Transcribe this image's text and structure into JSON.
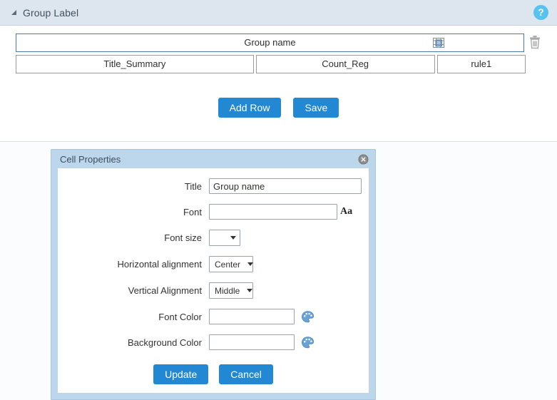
{
  "panel": {
    "title": "Group Label",
    "collapse_icon": "triangle-collapse-icon",
    "help_icon": "?",
    "help_icon_color": "#57c2ef"
  },
  "grid": {
    "rows": [
      {
        "selected": true,
        "cells": [
          {
            "text": "Group name"
          }
        ],
        "split_icon": "cell-split-icon",
        "delete_icon": "trash-icon"
      },
      {
        "selected": false,
        "cells": [
          {
            "text": "Title_Summary"
          },
          {
            "text": "Count_Reg"
          },
          {
            "text": "rule1"
          }
        ]
      }
    ]
  },
  "toolbar": {
    "add_row_label": "Add Row",
    "save_label": "Save",
    "button_color": "#2288d4"
  },
  "dialog": {
    "title": "Cell Properties",
    "close_icon": "close-circle-icon",
    "fields": {
      "title": {
        "label": "Title",
        "value": "Group name",
        "placeholder": ""
      },
      "font": {
        "label": "Font",
        "value": "",
        "placeholder": "",
        "picker_icon": "Aa"
      },
      "font_size": {
        "label": "Font size",
        "value": ""
      },
      "horizontal_alignment": {
        "label": "Horizontal alignment",
        "value": "Center"
      },
      "vertical_alignment": {
        "label": "Vertical Alignment",
        "value": "Middle"
      },
      "font_color": {
        "label": "Font Color",
        "value": "",
        "placeholder": "",
        "picker_icon": "palette-icon"
      },
      "background_color": {
        "label": "Background Color",
        "value": "",
        "placeholder": "",
        "picker_icon": "palette-icon"
      }
    },
    "buttons": {
      "update_label": "Update",
      "cancel_label": "Cancel"
    }
  }
}
